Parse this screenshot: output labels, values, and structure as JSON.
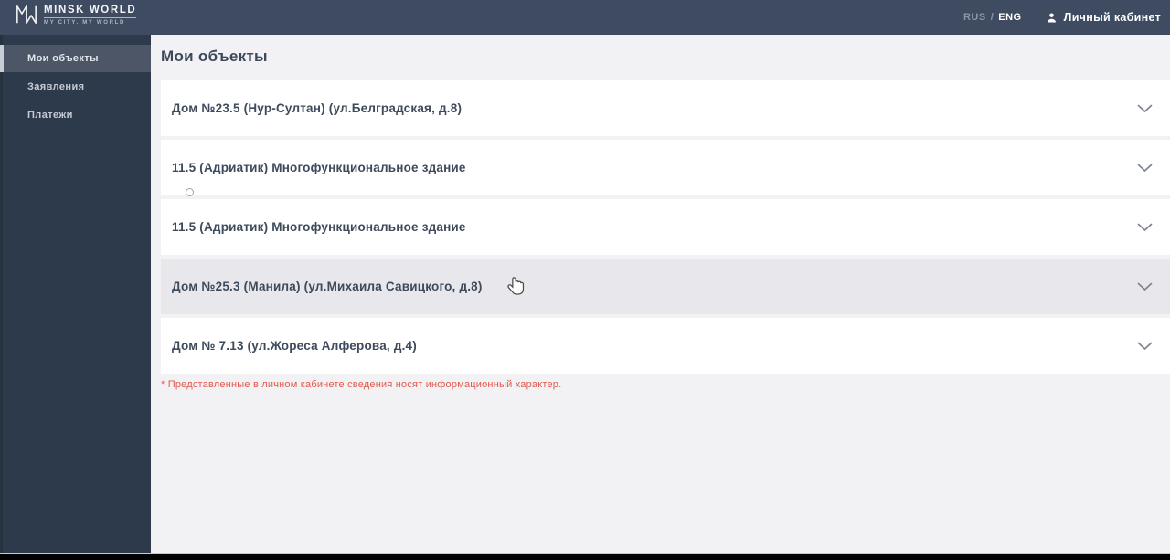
{
  "topbar": {
    "logo": {
      "title": "MINSK WORLD",
      "tagline": "MY CITY. MY WORLD"
    },
    "language": {
      "rus": "RUS",
      "divider": "/",
      "eng": "ENG",
      "selected": "ENG"
    },
    "account": {
      "label": "Личный кабинет"
    }
  },
  "sidebar": {
    "items": [
      {
        "label": "Мои объекты",
        "active": true
      },
      {
        "label": "Заявления",
        "active": false
      },
      {
        "label": "Платежи",
        "active": false
      }
    ]
  },
  "main": {
    "title": "Мои объекты",
    "objects": [
      {
        "label": "Дом №23.5 (Нур-Султан) (ул.Белградская, д.8)",
        "state": "default"
      },
      {
        "label": "11.5 (Адриатик) Многофункциональное здание",
        "state": "default"
      },
      {
        "label": "11.5 (Адриатик) Многофункциональное здание",
        "state": "default"
      },
      {
        "label": "Дом №25.3 (Манила) (ул.Михаила Савицкого, д.8)",
        "state": "hover"
      },
      {
        "label": "Дом № 7.13 (ул.Жореса Алферова, д.4)",
        "state": "default"
      }
    ],
    "footnote": "* Представленные в личном кабинете сведения носят информационный характер."
  },
  "icons": {
    "mw-logo-icon": "MW monogram",
    "user-icon": "person silhouette",
    "chevron-down-icon": "v",
    "cursor-pointer-icon": "hand pointer",
    "circle-indicator": "small outlined circle"
  },
  "colors": {
    "topbar": "#3e4b61",
    "sidebar": "#2d3a4c",
    "sidebar_active": "#4d5666",
    "accent_bar": "#c9ced6",
    "content_bg": "#f2f2f4",
    "card_bg": "#ffffff",
    "card_hover_bg": "#e8e8ec",
    "text_dark": "#3d4a5c",
    "muted_text": "#8b95a6",
    "footnote_red": "#e2584d",
    "chevron_gray": "#7d8591"
  }
}
